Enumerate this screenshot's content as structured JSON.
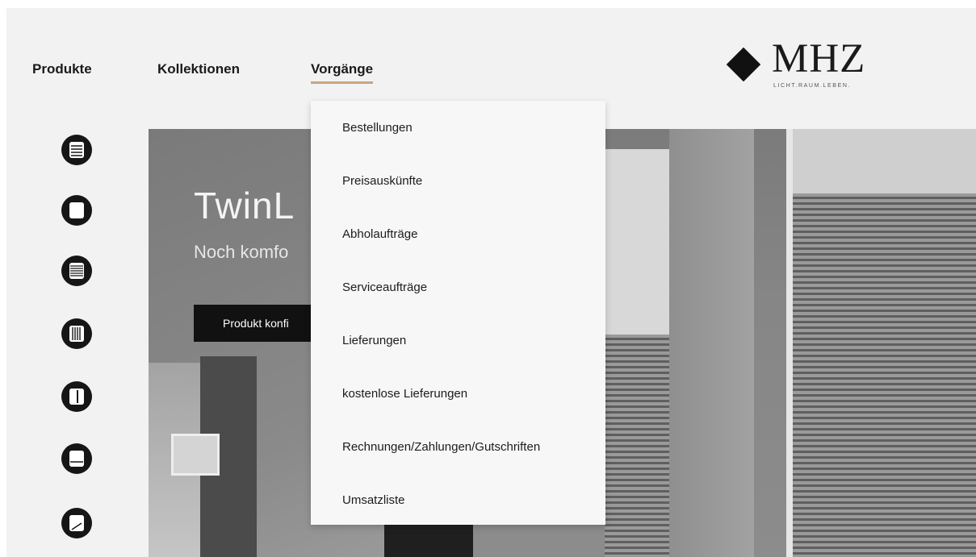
{
  "nav": {
    "items": [
      {
        "label": "Produkte"
      },
      {
        "label": "Kollektionen"
      },
      {
        "label": "Vorgänge"
      }
    ],
    "active_index": 2,
    "active_underline_color": "#c8a67e"
  },
  "logo": {
    "wordmark": "MHZ",
    "tagline": "LICHT.RAUM.LEBEN."
  },
  "side_icons": [
    {
      "icon": "pleated-blind-icon"
    },
    {
      "icon": "roller-blind-icon"
    },
    {
      "icon": "venetian-blind-icon"
    },
    {
      "icon": "vertical-blind-icon"
    },
    {
      "icon": "curtain-panel-icon"
    },
    {
      "icon": "roman-blind-icon"
    },
    {
      "icon": "awning-icon"
    }
  ],
  "hero": {
    "title": "TwinL",
    "subtitle": "Noch komfo",
    "button_label": "Produkt konfi"
  },
  "dropdown": {
    "items": [
      {
        "label": "Bestellungen"
      },
      {
        "label": "Preisauskünfte"
      },
      {
        "label": "Abholaufträge"
      },
      {
        "label": "Serviceaufträge"
      },
      {
        "label": "Lieferungen"
      },
      {
        "label": "kostenlose Lieferungen"
      },
      {
        "label": "Rechnungen/Zahlungen/Gutschriften"
      },
      {
        "label": "Umsatzliste"
      }
    ]
  }
}
